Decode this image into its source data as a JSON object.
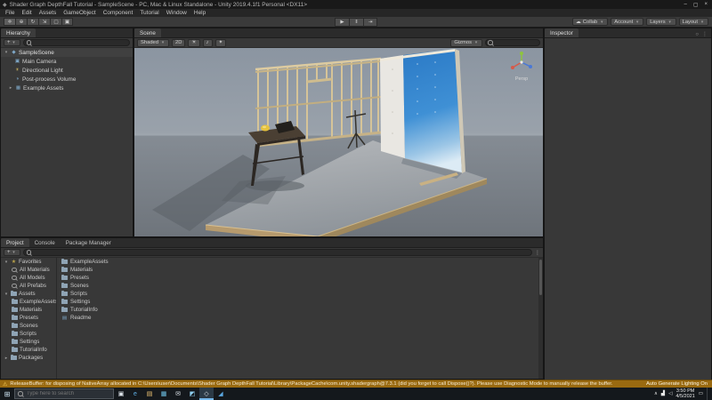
{
  "window": {
    "title": "Shader Graph DepthFall Tutorial - SampleScene - PC, Mac & Linux Standalone - Unity 2019.4.1f1 Personal <DX11>",
    "unity_icon": "◆",
    "minimize": "–",
    "maximize": "▢",
    "close": "×"
  },
  "menubar": {
    "items": [
      "File",
      "Edit",
      "Assets",
      "GameObject",
      "Component",
      "Tutorial",
      "Window",
      "Help"
    ]
  },
  "toolbar": {
    "tools": [
      "✛",
      "⊕",
      "↻",
      "⇲",
      "▢",
      "▣"
    ],
    "play": "▶",
    "pause": "‖",
    "step": "⇥",
    "cloud": "☁",
    "collab": "Collab",
    "account": "Account",
    "layers": "Layers",
    "layout": "Layout",
    "caret": "▾"
  },
  "hierarchy": {
    "tab": "Hierarchy",
    "create_label": "+",
    "caret": "▾",
    "collapsed_caret": "▸",
    "scene_label": "SampleScene",
    "items": [
      {
        "label": "Main Camera",
        "icon": "▣"
      },
      {
        "label": "Directional Light",
        "icon": "☀"
      },
      {
        "label": "Post-process Volume",
        "icon": "◑"
      },
      {
        "label": "Example Assets",
        "icon": "▦"
      }
    ]
  },
  "scene_view": {
    "tab": "Scene",
    "shaded_label": "Shaded",
    "two_d_label": "2D",
    "light_icon": "☀",
    "audio_icon": "♪",
    "fx_icon": "✦",
    "gizmos_label": "Gizmos",
    "caret": "▾",
    "persp_label": "Persp"
  },
  "inspector": {
    "tab": "Inspector",
    "lock_icon": "○",
    "menu_icon": "⋮"
  },
  "project": {
    "tabs": [
      "Project",
      "Console",
      "Package Manager"
    ],
    "create_label": "+",
    "caret": "▾",
    "menu_icon": "⋮",
    "favorites": {
      "label": "Favorites",
      "items": [
        "All Materials",
        "All Models",
        "All Prefabs"
      ]
    },
    "assets_label": "Assets",
    "folders": [
      "ExampleAssets",
      "Materials",
      "Presets",
      "Scenes",
      "Scripts",
      "Settings",
      "TutorialInfo"
    ],
    "packages_label": "Packages",
    "list": [
      "ExampleAssets",
      "Materials",
      "Presets",
      "Scenes",
      "Scripts",
      "Settings",
      "TutorialInfo",
      "Readme"
    ]
  },
  "statusbar": {
    "warning_icon": "⚠",
    "message": "ReleaseBuffer: for disposing of NativeArray allocated in C:\\Users\\user\\Documents\\Shader Graph DepthFall Tutorial\\Library\\PackageCache\\com.unity.shadergraph@7.3.1 (did you forget to call Dispose()?). Please use Diagnostic Mode to manually release the buffer.",
    "lighting_label": "Auto Generate Lighting On"
  },
  "taskbar": {
    "start": "⊞",
    "search_placeholder": "Type here to search",
    "icons": [
      {
        "name": "task-view",
        "glyph": "▣"
      },
      {
        "name": "edge",
        "glyph": "e"
      },
      {
        "name": "file-explorer",
        "glyph": "▤"
      },
      {
        "name": "store",
        "glyph": "▦"
      },
      {
        "name": "mail",
        "glyph": "✉"
      },
      {
        "name": "photos",
        "glyph": "◩"
      },
      {
        "name": "unity-app",
        "glyph": "◇"
      },
      {
        "name": "code-editor",
        "glyph": "◢"
      }
    ],
    "tray": {
      "chevron": "∧",
      "network": "▟",
      "volume": "◁",
      "time": "3:50 PM",
      "date": "4/5/2021",
      "notifications": "▭"
    }
  }
}
